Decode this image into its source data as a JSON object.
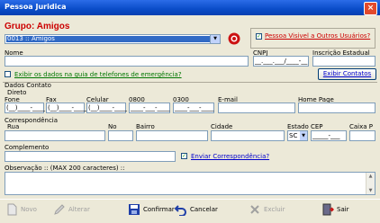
{
  "window": {
    "title": "Pessoa Juridica",
    "close": "×"
  },
  "group": {
    "title": "Grupo: Amigos",
    "selected": "0013 :: Amigos"
  },
  "visibility": {
    "label": "Pessoa Visivel a Outros Usuários?",
    "checked": "✓"
  },
  "fields": {
    "nome": "Nome",
    "cnpj": "CNPJ",
    "cnpj_mask": "__.___.___/____-__",
    "inscricao": "Inscrição Estadual"
  },
  "emergency": {
    "label": "Exibir os dados na guia de telefones de emergência?"
  },
  "exibir_contatos": "Exibir Contatos",
  "dados_contato": "Dados Contato",
  "direto": "Direto",
  "contact": {
    "fone": "Fone",
    "fax": "Fax",
    "celular": "Celular",
    "n0800": "0800",
    "n0300": "0300",
    "email": "E-mail",
    "home": "Home Page",
    "fone_mask": "(__)____-____",
    "fax_mask": "(__)____-____",
    "cel_mask": "(__)____-____",
    "m0800": "____-___-____",
    "m0300": "____-___-____"
  },
  "correspondencia": {
    "title": "Correspondência",
    "rua": "Rua",
    "no": "No",
    "bairro": "Bairro",
    "cidade": "Cidade",
    "estado": "Estado",
    "estado_value": "SC",
    "cep": "CEP",
    "cep_mask": "_____-___",
    "caixa": "Caixa P"
  },
  "complemento": "Complemento",
  "enviar": {
    "label": "Enviar Correspondência?",
    "checked": "✓"
  },
  "observacao": "Observação :: (MAX 200 caracteres) ::",
  "toolbar": {
    "novo": "Novo",
    "alterar": "Alterar",
    "confirmar": "Confirmar",
    "cancelar": "Cancelar",
    "excluir": "Excluir",
    "sair": "Sair"
  }
}
